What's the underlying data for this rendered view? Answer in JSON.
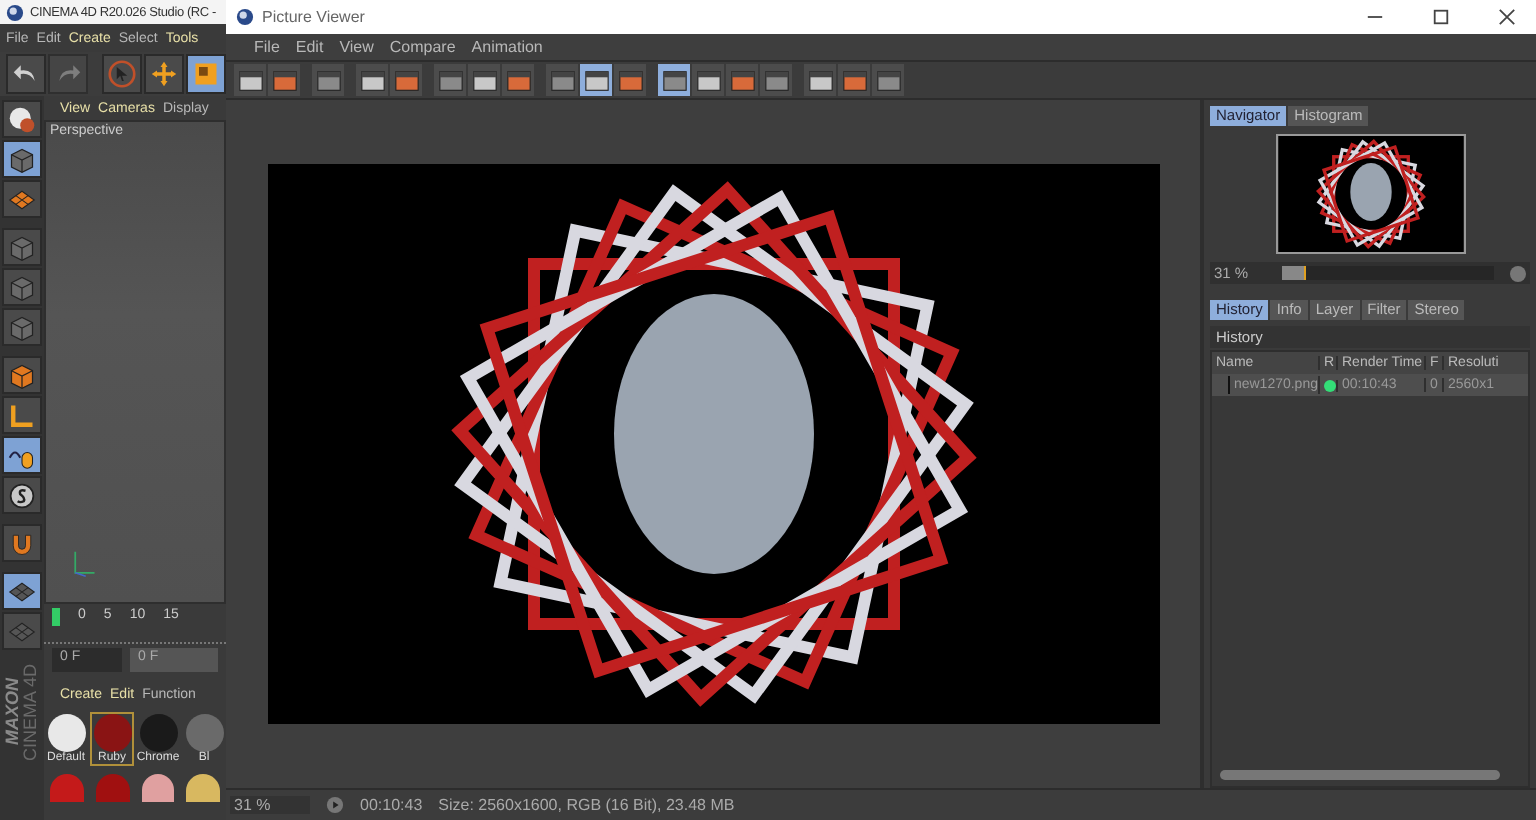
{
  "c4d": {
    "title": "CINEMA 4D R20.026 Studio (RC -",
    "menu": [
      "File",
      "Edit",
      "Create",
      "Select",
      "Tools"
    ],
    "toolbar": [
      {
        "selected": false,
        "disabled": false
      },
      {
        "selected": false,
        "disabled": true
      },
      {
        "selected": false,
        "disabled": false
      },
      {
        "selected": false,
        "disabled": false
      },
      {
        "selected": true,
        "disabled": false
      }
    ],
    "side_tools": [
      {
        "selected": false
      },
      {
        "selected": true
      },
      {
        "selected": false
      },
      {
        "selected": false
      },
      {
        "selected": false
      },
      {
        "selected": false
      },
      {
        "selected": false
      },
      {
        "selected": false
      },
      {
        "selected": true
      },
      {
        "selected": false
      },
      {
        "selected": false
      },
      {
        "selected": true
      },
      {
        "selected": false
      }
    ],
    "viewport": {
      "menu": [
        "View",
        "Cameras",
        "Display"
      ],
      "label": "Perspective"
    },
    "timeline": {
      "ticks": [
        "0",
        "5",
        "10",
        "15"
      ]
    },
    "frame_fields": [
      "0 F",
      "0 F"
    ],
    "materials_menu": [
      "Create",
      "Edit",
      "Function"
    ],
    "materials": [
      {
        "name": "Default",
        "color": "#e8e8e8",
        "selected": false
      },
      {
        "name": "Ruby",
        "color": "#8a1414",
        "selected": true
      },
      {
        "name": "Chrome",
        "color": "#1a1a1a",
        "selected": false
      },
      {
        "name": "Bl",
        "color": "#6a6a6a",
        "selected": false
      }
    ],
    "materials_row_2": [
      {
        "color": "#c41a1a"
      },
      {
        "color": "#a01010"
      },
      {
        "color": "#e0a0a0"
      },
      {
        "color": "#d8b860"
      }
    ],
    "logo": [
      "MAXON",
      "CINEMA 4D"
    ]
  },
  "viewer": {
    "title": "Picture Viewer",
    "menu": [
      "File",
      "Edit",
      "View",
      "Compare",
      "Animation"
    ],
    "toolbar": [
      {
        "selected": false
      },
      {
        "selected": false
      },
      {
        "selected": false
      },
      {
        "selected": false
      },
      {
        "selected": false
      },
      {
        "selected": false
      },
      {
        "selected": false
      },
      {
        "selected": false
      },
      {
        "selected": false
      },
      {
        "selected": true
      },
      {
        "selected": false
      },
      {
        "selected": true
      },
      {
        "selected": false
      },
      {
        "selected": false
      },
      {
        "selected": false
      },
      {
        "selected": false
      },
      {
        "selected": false
      },
      {
        "selected": false
      }
    ],
    "navigator": {
      "tabs": [
        {
          "label": "Navigator",
          "selected": true
        },
        {
          "label": "Histogram",
          "selected": false
        }
      ],
      "zoom": "31 %",
      "level": 0.1
    },
    "history": {
      "tabs": [
        {
          "label": "History",
          "selected": true
        },
        {
          "label": "Info",
          "selected": false
        },
        {
          "label": "Layer",
          "selected": false
        },
        {
          "label": "Filter",
          "selected": false
        },
        {
          "label": "Stereo",
          "selected": false
        }
      ],
      "header": "History",
      "columns": [
        "Name",
        "R",
        "Render Time",
        "F",
        "Resoluti"
      ],
      "rows": [
        {
          "name": "new1270.png",
          "color": "#33dd77",
          "render_time": "00:10:43",
          "frame": "0",
          "resolution": "2560x1"
        }
      ]
    },
    "status_bar": {
      "zoom": "31 %",
      "time": "00:10:43",
      "info": "Size: 2560x1600, RGB (16 Bit), 23.48 MB"
    }
  }
}
